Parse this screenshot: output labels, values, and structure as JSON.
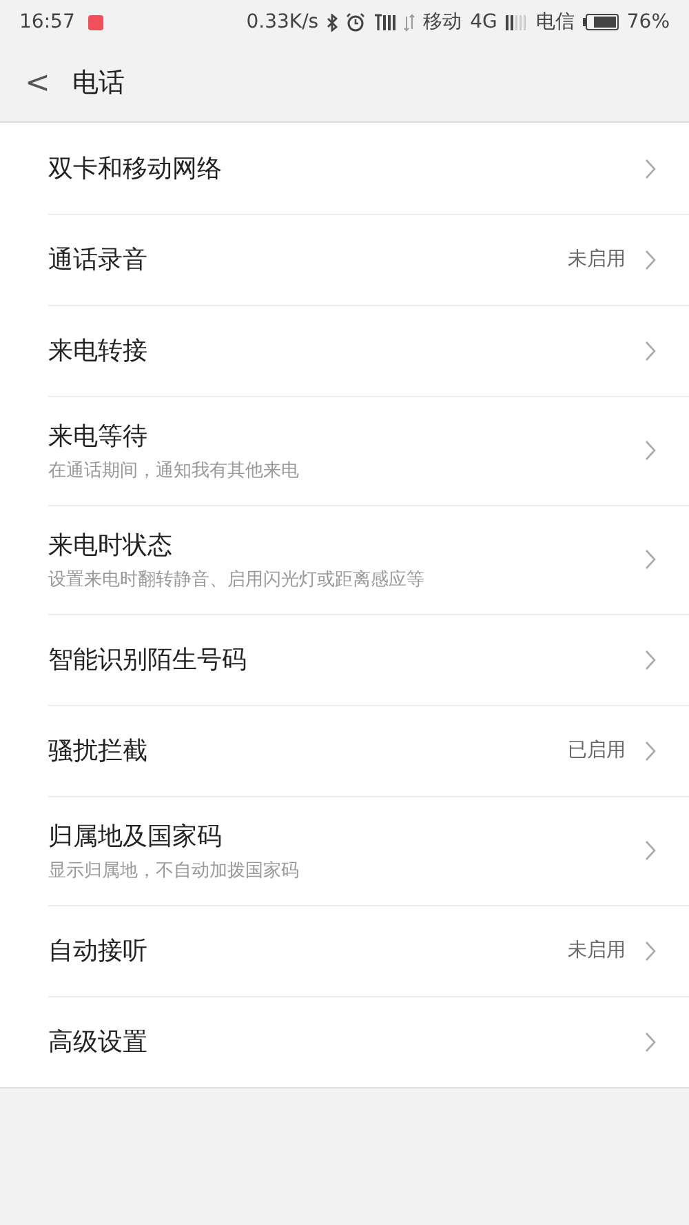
{
  "status_bar": {
    "time": "16:57",
    "speed": "0.33K/s",
    "carrier_1": "移动",
    "network_1": "4G",
    "carrier_2": "电信",
    "battery": "76%"
  },
  "header": {
    "back": "<",
    "title": "电话"
  },
  "items": [
    {
      "title": "双卡和移动网络"
    },
    {
      "title": "通话录音",
      "value": "未启用"
    },
    {
      "title": "来电转接"
    },
    {
      "title": "来电等待",
      "subtitle": "在通话期间，通知我有其他来电"
    },
    {
      "title": "来电时状态",
      "subtitle": "设置来电时翻转静音、启用闪光灯或距离感应等"
    },
    {
      "title": "智能识别陌生号码"
    },
    {
      "title": "骚扰拦截",
      "value": "已启用"
    },
    {
      "title": "归属地及国家码",
      "subtitle": "显示归属地，不自动加拨国家码"
    },
    {
      "title": "自动接听",
      "value": "未启用"
    },
    {
      "title": "高级设置"
    }
  ]
}
